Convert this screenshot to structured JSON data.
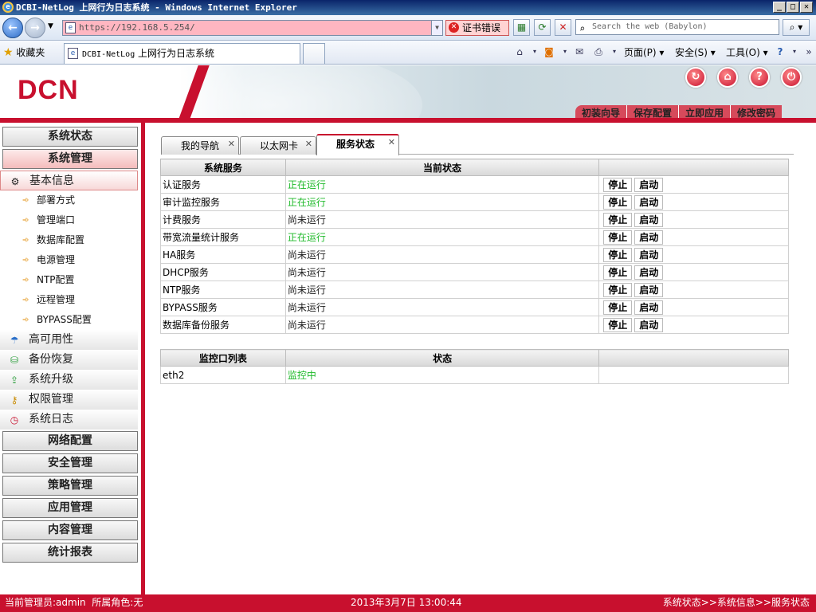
{
  "window": {
    "title": "DCBI-NetLog 上网行为日志系统 - Windows Internet Explorer",
    "controls": [
      "_",
      "□",
      "✕"
    ]
  },
  "browser": {
    "address": "https://192.168.5.254/",
    "cert_error": "证书错误",
    "search_placeholder": "Search the web (Babylon)",
    "favorites_label": "收藏夹",
    "tab_title_prefix": "DCBI-NetLog",
    "tab_title_suffix": " 上网行为日志系统",
    "commands": {
      "page": "页面(P)",
      "safety": "安全(S)",
      "tools": "工具(O)"
    }
  },
  "header": {
    "logo": "DCN",
    "top_nav": [
      "初装向导",
      "保存配置",
      "立即应用",
      "修改密码"
    ]
  },
  "sidebar": {
    "groups_top": [
      "系统状态",
      "系统管理"
    ],
    "submenus": [
      {
        "label": "基本信息",
        "icon": "gears-icon"
      },
      {
        "label": "高可用性",
        "icon": "umbrella-icon"
      },
      {
        "label": "备份恢复",
        "icon": "backup-icon"
      },
      {
        "label": "系统升级",
        "icon": "upgrade-icon"
      },
      {
        "label": "权限管理",
        "icon": "key-icon"
      },
      {
        "label": "系统日志",
        "icon": "clock-icon"
      }
    ],
    "leaves": [
      "部署方式",
      "管理端口",
      "数据库配置",
      "电源管理",
      "NTP配置",
      "远程管理",
      "BYPASS配置"
    ],
    "groups_bottom": [
      "网络配置",
      "安全管理",
      "策略管理",
      "应用管理",
      "内容管理",
      "统计报表"
    ]
  },
  "content": {
    "tabs": [
      "我的导航",
      "以太网卡",
      "服务状态"
    ],
    "services": {
      "headers": [
        "系统服务",
        "当前状态",
        ""
      ],
      "rows": [
        {
          "name": "认证服务",
          "status": "正在运行",
          "running": true
        },
        {
          "name": "审计监控服务",
          "status": "正在运行",
          "running": true
        },
        {
          "name": "计费服务",
          "status": "尚未运行",
          "running": false
        },
        {
          "name": "带宽流量统计服务",
          "status": "正在运行",
          "running": true
        },
        {
          "name": "HA服务",
          "status": "尚未运行",
          "running": false
        },
        {
          "name": "DHCP服务",
          "status": "尚未运行",
          "running": false
        },
        {
          "name": "NTP服务",
          "status": "尚未运行",
          "running": false
        },
        {
          "name": "BYPASS服务",
          "status": "尚未运行",
          "running": false
        },
        {
          "name": "数据库备份服务",
          "status": "尚未运行",
          "running": false
        }
      ],
      "stop_label": "停止",
      "start_label": "启动"
    },
    "monitor": {
      "headers": [
        "监控口列表",
        "状态",
        ""
      ],
      "rows": [
        {
          "port": "eth2",
          "status": "监控中"
        }
      ]
    }
  },
  "statusbar": {
    "user": "当前管理员:admin  所属角色:无",
    "datetime": "2013年3月7日 13:00:44",
    "breadcrumb": "系统状态>>系统信息>>服务状态"
  },
  "colors": {
    "brand_red": "#c8102e",
    "running_green": "#1fba2a"
  }
}
